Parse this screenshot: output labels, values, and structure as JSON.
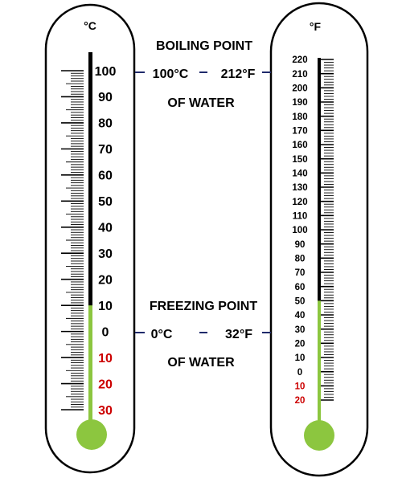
{
  "celsius": {
    "unit_label": "°C",
    "tick_labels": [
      "100",
      "90",
      "80",
      "70",
      "60",
      "50",
      "40",
      "30",
      "20",
      "10",
      "0",
      "10",
      "20",
      "30"
    ],
    "tick_values": [
      100,
      90,
      80,
      70,
      60,
      50,
      40,
      30,
      20,
      10,
      0,
      -10,
      -20,
      -30
    ],
    "liquid_level": 10,
    "stem_color": "#000000",
    "liquid_color": "#8cc63f",
    "negative_color": "#cc0000"
  },
  "fahrenheit": {
    "unit_label": "°F",
    "tick_labels": [
      "220",
      "210",
      "200",
      "190",
      "180",
      "170",
      "160",
      "150",
      "140",
      "130",
      "120",
      "110",
      "100",
      "90",
      "80",
      "70",
      "60",
      "50",
      "40",
      "30",
      "20",
      "10",
      "0",
      "10",
      "20"
    ],
    "tick_values": [
      220,
      210,
      200,
      190,
      180,
      170,
      160,
      150,
      140,
      130,
      120,
      110,
      100,
      90,
      80,
      70,
      60,
      50,
      40,
      30,
      20,
      10,
      0,
      -10,
      -20
    ],
    "liquid_level": 50,
    "stem_color": "#000000",
    "liquid_color": "#8cc63f",
    "negative_color": "#cc0000"
  },
  "boiling": {
    "title_line1": "BOILING POINT",
    "title_line2": "OF WATER",
    "celsius_value": "100°C",
    "fahrenheit_value": "212°F"
  },
  "freezing": {
    "title_line1": "FREEZING POINT",
    "title_line2": "OF WATER",
    "celsius_value": "0°C",
    "fahrenheit_value": "32°F"
  },
  "connector_color": "#1f2a6b"
}
